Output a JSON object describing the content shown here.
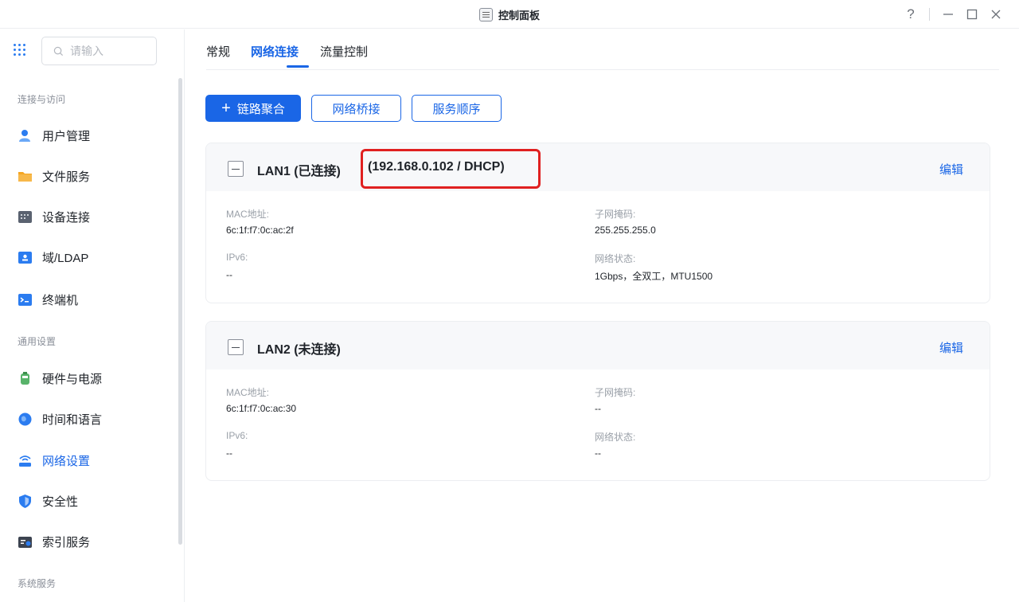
{
  "window": {
    "title": "控制面板",
    "help_glyph": "?",
    "controls": [
      "minimize",
      "maximize",
      "close"
    ]
  },
  "sidebar": {
    "search_placeholder": "请输入",
    "sections": [
      {
        "label": "连接与访问",
        "items": [
          {
            "label": "用户管理",
            "icon": "user-icon",
            "color": "#2b7cf0"
          },
          {
            "label": "文件服务",
            "icon": "folder-icon",
            "color": "#f5a623"
          },
          {
            "label": "设备连接",
            "icon": "device-icon",
            "color": "#5a6270"
          },
          {
            "label": "域/LDAP",
            "icon": "directory-icon",
            "color": "#2b7cf0"
          },
          {
            "label": "终端机",
            "icon": "terminal-icon",
            "color": "#2b7cf0"
          }
        ]
      },
      {
        "label": "通用设置",
        "items": [
          {
            "label": "硬件与电源",
            "icon": "hardware-icon",
            "color": "#58b36a"
          },
          {
            "label": "时间和语言",
            "icon": "globe-icon",
            "color": "#2b7cf0"
          },
          {
            "label": "网络设置",
            "icon": "network-icon",
            "color": "#2b7cf0",
            "active": true
          },
          {
            "label": "安全性",
            "icon": "shield-icon",
            "color": "#2b7cf0"
          },
          {
            "label": "索引服务",
            "icon": "index-icon",
            "color": "#3c4350"
          }
        ]
      },
      {
        "label": "系统服务",
        "items": []
      }
    ]
  },
  "main": {
    "tabs": [
      {
        "label": "常规"
      },
      {
        "label": "网络连接",
        "active": true
      },
      {
        "label": "流量控制"
      }
    ],
    "toolbar": {
      "link_aggregation": "链路聚合",
      "plus_glyph": "+",
      "network_bridge": "网络桥接",
      "service_order": "服务顺序"
    },
    "interfaces": [
      {
        "title": "LAN1 (已连接)",
        "ip": "(192.168.0.102 / DHCP)",
        "edit": "编辑",
        "mac_label": "MAC地址:",
        "mac_value": "6c:1f:f7:0c:ac:2f",
        "subnet_label": "子网掩码:",
        "subnet_value": "255.255.255.0",
        "ipv6_label": "IPv6:",
        "ipv6_value": "--",
        "status_label": "网络状态:",
        "status_value": "1Gbps，全双工，MTU1500",
        "highlight_color": "#e02020"
      },
      {
        "title": "LAN2 (未连接)",
        "ip": "",
        "edit": "编辑",
        "mac_label": "MAC地址:",
        "mac_value": "6c:1f:f7:0c:ac:30",
        "subnet_label": "子网掩码:",
        "subnet_value": "--",
        "ipv6_label": "IPv6:",
        "ipv6_value": "--",
        "status_label": "网络状态:",
        "status_value": "--"
      }
    ]
  },
  "colors": {
    "accent": "#1a66e6",
    "highlight": "#e02020"
  }
}
